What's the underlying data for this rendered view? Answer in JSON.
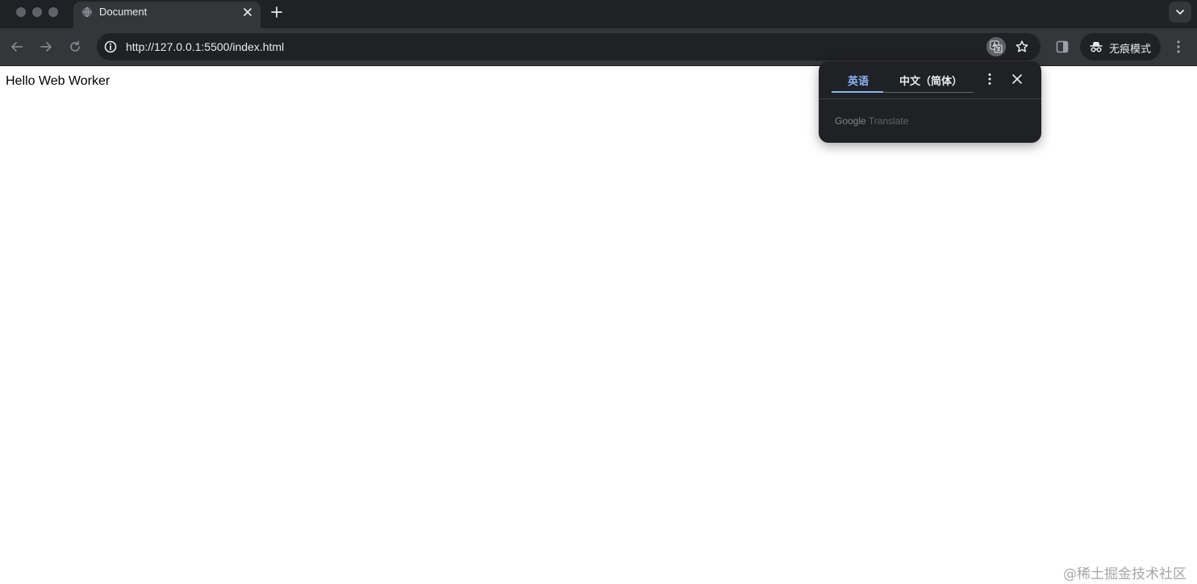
{
  "browser": {
    "tab": {
      "title": "Document"
    },
    "address_bar": {
      "url": "http://127.0.0.1:5500/index.html"
    },
    "profile": {
      "label": "无痕模式"
    }
  },
  "page": {
    "body_text": "Hello Web Worker"
  },
  "translate_bubble": {
    "source_language": "英语",
    "target_language": "中文（简体）",
    "brand_google": "Google",
    "brand_translate": "Translate"
  },
  "watermark": "@稀土掘金技术社区",
  "colors": {
    "accent": "#8ab4f8",
    "chrome_dark": "#202124",
    "toolbar": "#35363a",
    "text_light": "#e8eaed"
  },
  "icons": [
    "globe-icon",
    "close-icon",
    "plus-icon",
    "chevron-down-icon",
    "back-icon",
    "forward-icon",
    "reload-icon",
    "info-icon",
    "translate-icon",
    "star-icon",
    "side-panel-icon",
    "incognito-icon",
    "more-vert-icon"
  ]
}
